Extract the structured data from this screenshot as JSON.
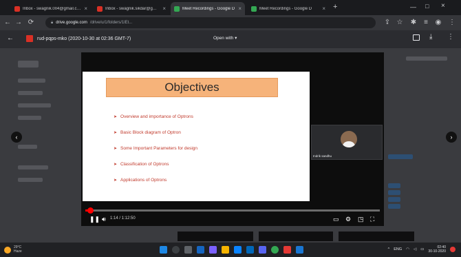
{
  "browser": {
    "tabs": [
      {
        "label": "Inbox - swagnik.004@gmail.com",
        "favicon_color": "#d93025",
        "active": false
      },
      {
        "label": "Inbox - swagnik.sikdar@gmail.c",
        "favicon_color": "#d93025",
        "active": false
      },
      {
        "label": "Meet Recordings - Google D",
        "favicon_color": "#34a853",
        "active": true
      },
      {
        "label": "Meet Recordings - Google D",
        "favicon_color": "#34a853",
        "active": false
      }
    ],
    "new_tab_label": "+",
    "address": {
      "domain": "drive.google.com",
      "path": "/drive/u/1/folders/1lEt..."
    }
  },
  "preview": {
    "back_label": "←",
    "file_name": "rud-pqps-mko (2020-10-30 at 02:36 GMT-7)",
    "open_with_label": "Open with ▾"
  },
  "video": {
    "slide": {
      "title": "Objectives",
      "bullets": [
        "Overview and importance of Optrons",
        "Basic Block diagram of Optron",
        "Some Important Parameters for design",
        "Classification of Optrons",
        "Applications of Optrons"
      ]
    },
    "participant_name": "Indrik sandhu",
    "time": "1:14 / 1:12:50",
    "progress_fraction": 0.017,
    "accent": "#ff0000"
  },
  "colors": {
    "slide_title_bg": "#f6b37a",
    "bullet_text": "#c0392b",
    "drive_pdf_red": "#d93025"
  },
  "taskbar": {
    "weather_temp": "29°C",
    "weather_text": "Haze",
    "clock_time": "02:40",
    "clock_date": "30-10-2020",
    "lang": "ENG"
  }
}
